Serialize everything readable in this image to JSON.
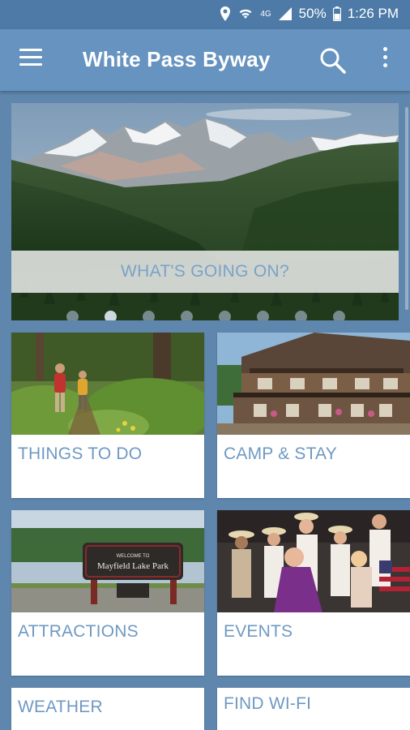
{
  "status_bar": {
    "battery": "50%",
    "time": "1:26 PM",
    "network": "4G"
  },
  "app_bar": {
    "title": "White Pass Byway"
  },
  "hero": {
    "caption": "WHAT'S GOING ON?",
    "dot_count": 8,
    "active_dot": 2
  },
  "tiles": [
    {
      "label": "THINGS TO DO"
    },
    {
      "label": "CAMP & STAY"
    },
    {
      "label": "ATTRACTIONS"
    },
    {
      "label": "EVENTS"
    },
    {
      "label": "WEATHER"
    },
    {
      "label": "FIND WI-FI"
    }
  ],
  "sign": {
    "line1": "WELCOME TO",
    "line2": "Mayfield Lake Park"
  },
  "colors": {
    "app_bar": "#6693bf",
    "status_bar": "#4d7aa6",
    "background": "#5f86ad",
    "tile_label": "#6f99c2",
    "hero_caption": "#7aa2c9"
  }
}
